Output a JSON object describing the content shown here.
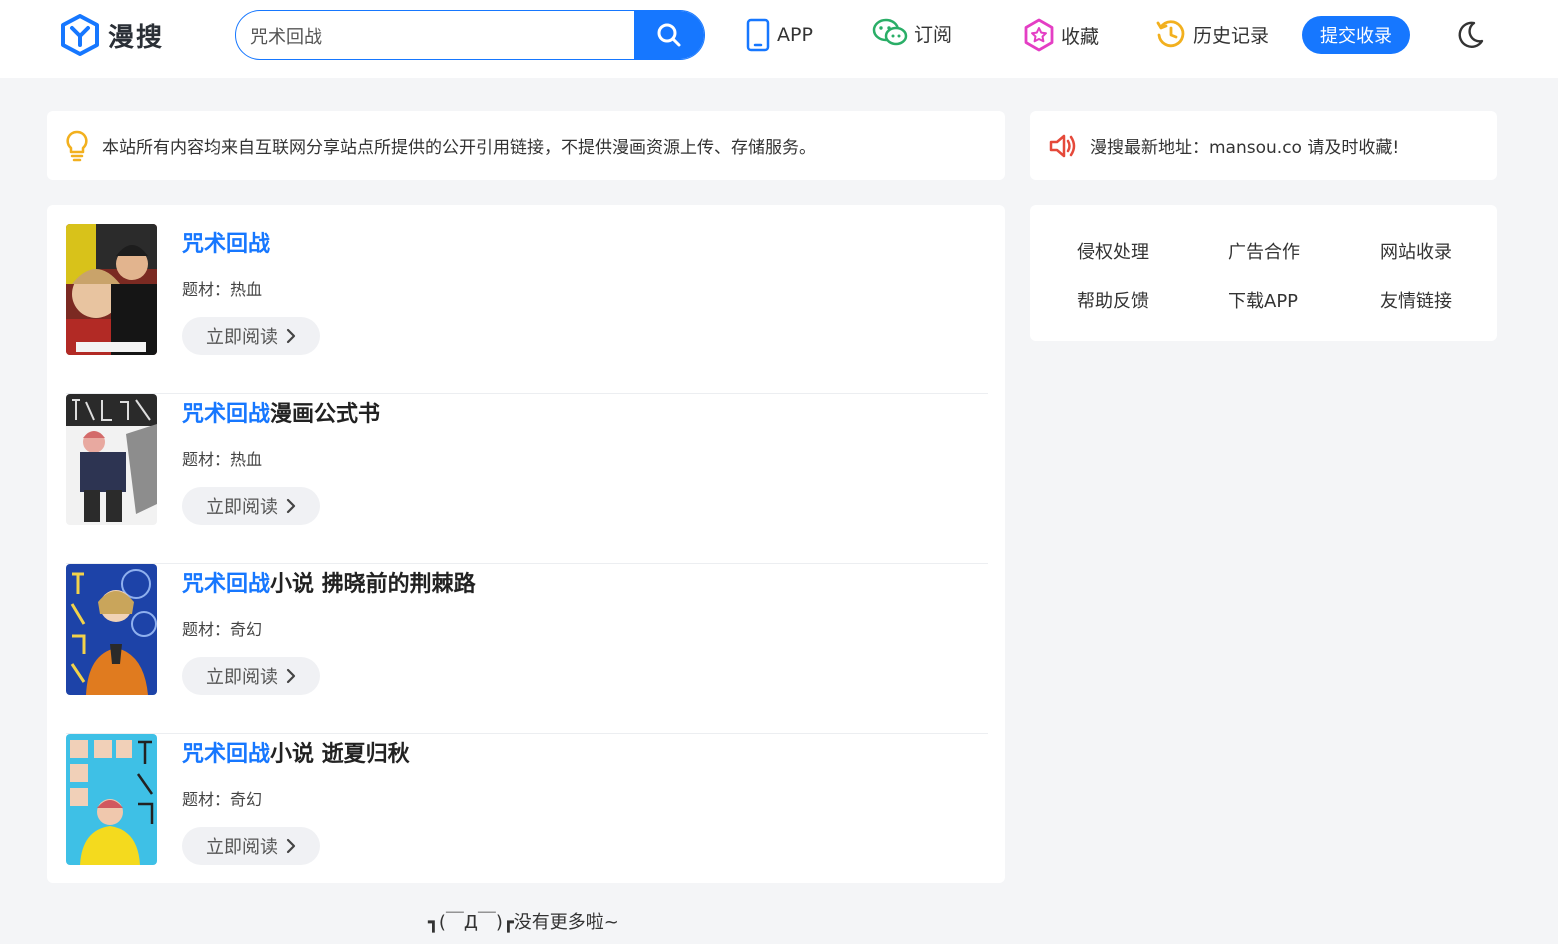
{
  "header": {
    "logo_text": "漫搜",
    "search": {
      "value": "咒术回战",
      "placeholder": ""
    },
    "nav": [
      {
        "label": "APP",
        "icon": "phone-icon"
      },
      {
        "label": "订阅",
        "icon": "wechat-icon"
      },
      {
        "label": "收藏",
        "icon": "favorites-icon"
      },
      {
        "label": "历史记录",
        "icon": "history-icon"
      }
    ],
    "submit_label": "提交收录",
    "theme_toggle_icon": "moon-icon"
  },
  "notice": {
    "icon": "lightbulb-icon",
    "text": "本站所有内容均来自互联网分享站点所提供的公开引用链接，不提供漫画资源上传、存储服务。"
  },
  "announce": {
    "icon": "speaker-icon",
    "text": "漫搜最新地址：mansou.co 请及时收藏!"
  },
  "results": [
    {
      "title_highlight": "咒术回战",
      "title_rest": "",
      "genre": "题材：热血",
      "read_label": "立即阅读"
    },
    {
      "title_highlight": "咒术回战",
      "title_rest": "漫画公式书",
      "genre": "题材：热血",
      "read_label": "立即阅读"
    },
    {
      "title_highlight": "咒术回战",
      "title_rest": "小说 拂晓前的荆棘路",
      "genre": "题材：奇幻",
      "read_label": "立即阅读"
    },
    {
      "title_highlight": "咒术回战",
      "title_rest": "小说 逝夏归秋",
      "genre": "题材：奇幻",
      "read_label": "立即阅读"
    }
  ],
  "side_links": [
    "侵权处理",
    "广告合作",
    "网站收录",
    "帮助反馈",
    "下载APP",
    "友情链接"
  ],
  "footer_msg": "┓(￣Д￣)┏没有更多啦~",
  "colors": {
    "accent": "#1677ff",
    "background": "#f4f5f7",
    "speaker": "#e5493a",
    "bulb": "#f2b01e"
  }
}
